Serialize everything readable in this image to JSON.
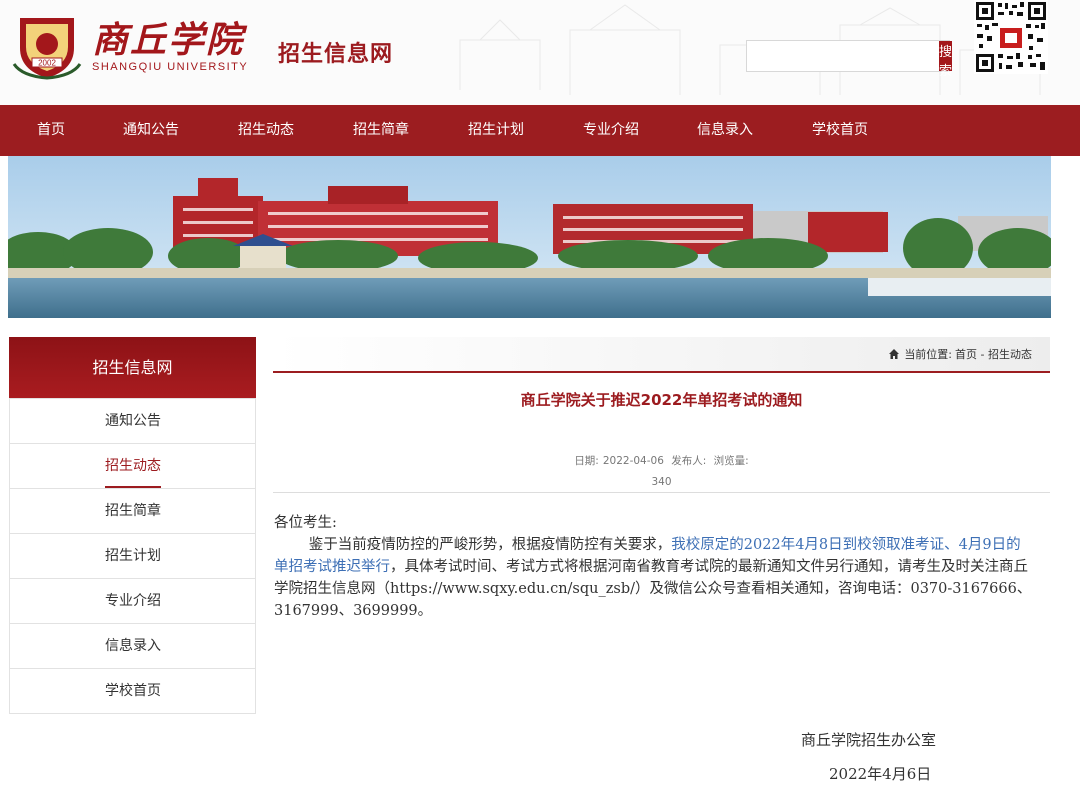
{
  "header": {
    "logo_cn": "商丘学院",
    "logo_en": "SHANGQIU UNIVERSITY",
    "emblem_year": "2002",
    "site_name": "招生信息网",
    "search_placeholder": "",
    "search_button": "搜索",
    "qr_icon": "qr-code-icon"
  },
  "nav": {
    "items": [
      {
        "label": "首页"
      },
      {
        "label": "通知公告"
      },
      {
        "label": "招生动态"
      },
      {
        "label": "招生简章"
      },
      {
        "label": "招生计划"
      },
      {
        "label": "专业介绍"
      },
      {
        "label": "信息录入"
      },
      {
        "label": "学校首页"
      }
    ]
  },
  "sidebar": {
    "title": "招生信息网",
    "items": [
      {
        "label": "通知公告"
      },
      {
        "label": "招生动态"
      },
      {
        "label": "招生简章"
      },
      {
        "label": "招生计划"
      },
      {
        "label": "专业介绍"
      },
      {
        "label": "信息录入"
      },
      {
        "label": "学校首页"
      }
    ],
    "active_label": "招生动态"
  },
  "breadcrumb": {
    "prefix": "当前位置:",
    "home": "首页",
    "sep": " - ",
    "current": "招生动态"
  },
  "article": {
    "title": "商丘学院关于推迟2022年单招考试的通知",
    "date_label": "日期:",
    "date": "2022-04-06",
    "publisher_label": "发布人:",
    "views_label": "浏览量:",
    "views": "340",
    "greeting": "各位考生:",
    "body_1": "鉴于当前疫情防控的严峻形势，根据疫情防控有关要求，",
    "body_highlight": "我校原定的2022年4月8日到校领取准考证、4月9日的单招考试推迟举行",
    "body_2": "，具体考试时间、考试方式将根据河南省教育考试院的最新通知文件另行通知，请考生及时关注商丘学院招生信息网（https://www.sqxy.edu.cn/squ_zsb/）及微信公众号查看相关通知，咨询电话：0370-3167666、3167999、3699999。",
    "signature": "商丘学院招生办公室",
    "sign_date": "2022年4月6日"
  },
  "colors": {
    "brand_red": "#9c1d20",
    "link_blue": "#3d6fb5"
  }
}
